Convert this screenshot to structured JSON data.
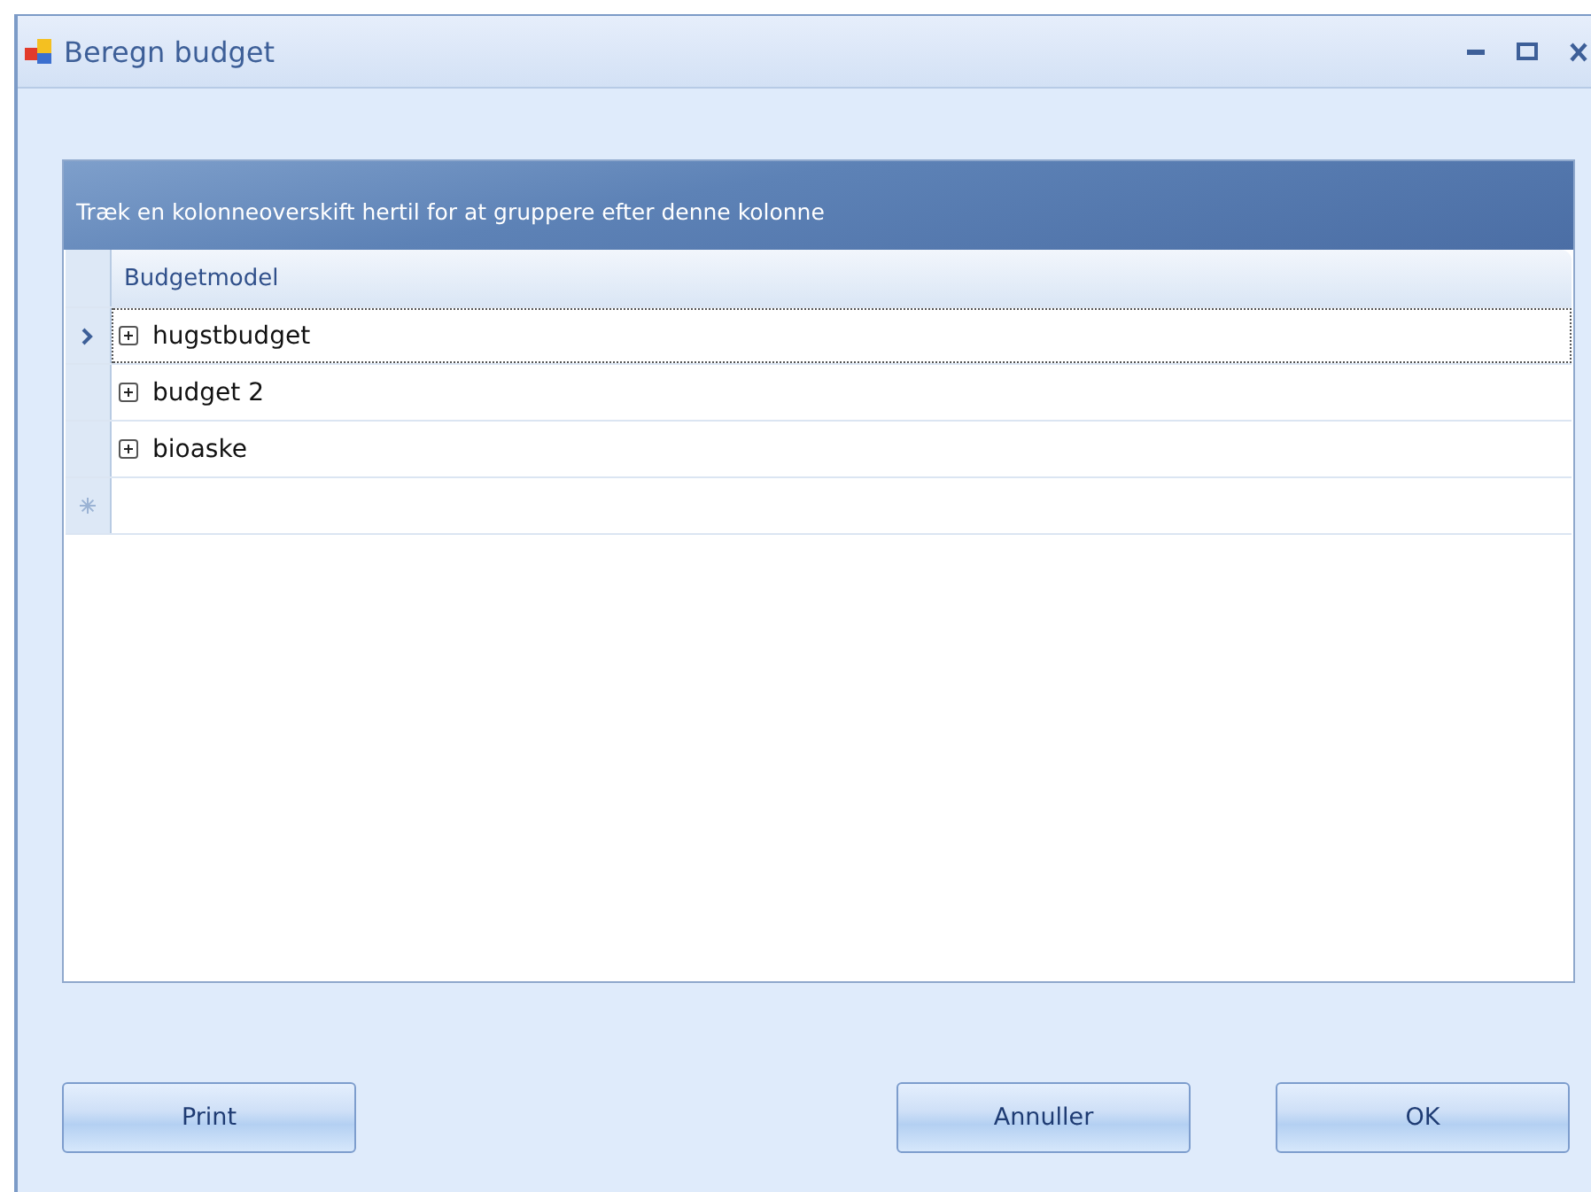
{
  "window": {
    "title": "Beregn budget"
  },
  "grid": {
    "group_hint": "Træk en kolonneoverskift hertil for at gruppere efter denne kolonne",
    "columns": [
      "Budgetmodel"
    ],
    "rows": [
      {
        "label": "hugstbudget",
        "selected": true,
        "expanded": false
      },
      {
        "label": "budget 2",
        "selected": false,
        "expanded": false
      },
      {
        "label": "bioaske",
        "selected": false,
        "expanded": false
      }
    ]
  },
  "buttons": [
    {
      "label": "Print",
      "kind": "left"
    },
    {
      "label": "Annuller",
      "kind": "right"
    },
    {
      "label": "OK",
      "kind": "right"
    }
  ]
}
